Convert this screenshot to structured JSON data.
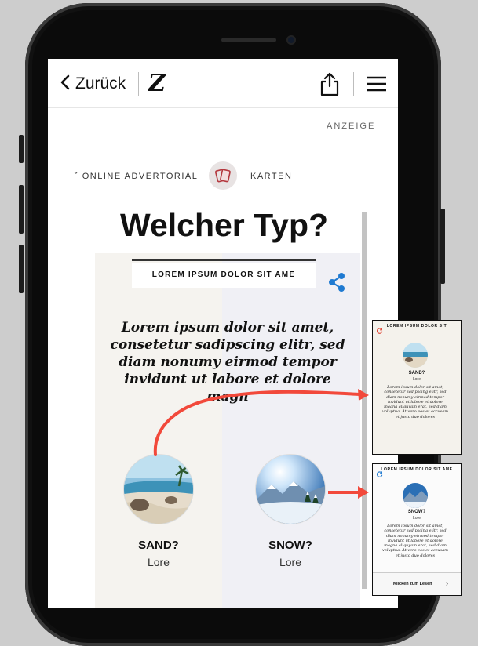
{
  "nav": {
    "back_label": "Zurück",
    "brand_letter": "Z"
  },
  "ad": {
    "label": "ANZEIGE",
    "breadcrumb_left": "˘ ONLINE ADVERTORIAL",
    "breadcrumb_right": "KARTEN",
    "breadcrumb_icon": "cards-icon"
  },
  "headline": "Welcher Typ?",
  "card": {
    "title": "LOREM IPSUM DOLOR SIT AME",
    "body": "Lorem ipsum dolor sit amet, consetetur sadipscing elitr, sed diam nonumy eirmod tempor invidunt ut labore et dolore magn",
    "options": [
      {
        "name": "SAND?",
        "sub": "Lore",
        "image": "beach-photo"
      },
      {
        "name": "SNOW?",
        "sub": "Lore",
        "image": "snow-mountain-photo"
      }
    ]
  },
  "previews": [
    {
      "title": "LOREM IPSUM DOLOR SIT",
      "name": "SAND?",
      "sub": "Lore",
      "body": "Lorem ipsum dolor sit amet, consetetur sadipscing elitr, sed diam nonumy eirmod tempor invidunt ut labore et dolore magna aliquyam erat, sed diam voluptua. At vero eos et accusam et justo duo dolores"
    },
    {
      "title": "LOREM IPSUM DOLOR SIT AME",
      "name": "SNOW?",
      "sub": "Lore",
      "body": "Lorem ipsum dolor sit amet, consetetur sadipscing elitr, sed diam nonumy eirmod tempor invidunt ut labore et dolore magna aliquyam erat, sed diam voluptua. At vero eos et accusam et justo duo dolores",
      "footer_label": "Klicken zum Lesen"
    }
  ],
  "colors": {
    "arrow": "#f2493b",
    "share_accent": "#1f7ad1",
    "card_bg": "#f5f3ef",
    "card_bg_right": "#f0f0f5"
  }
}
